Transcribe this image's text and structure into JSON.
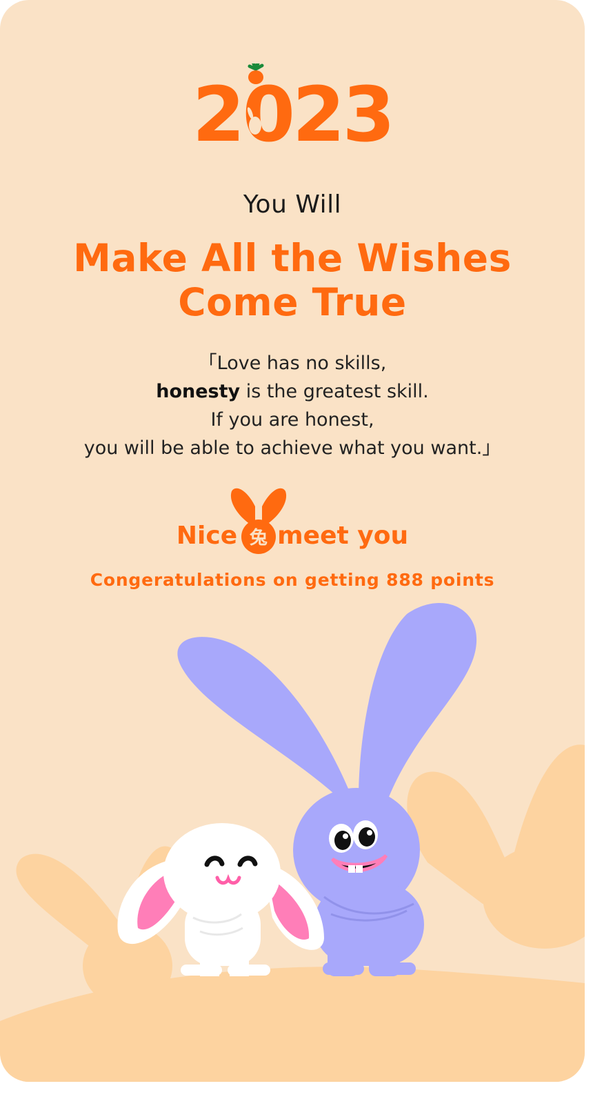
{
  "year": "2023",
  "subtitle": "You Will",
  "headline": {
    "line1": "Make All the Wishes",
    "line2": "Come True"
  },
  "quote": {
    "line1": "「Love has no skills,",
    "line2_bold": "honesty",
    "line2_rest": " is the greatest skill.",
    "line3": "If you are honest,",
    "line4": "you will be able to achieve what you want.」"
  },
  "greeting": {
    "left": "Nice",
    "right": "meet you"
  },
  "congrats": "Congeratulations on getting 888 points",
  "colors": {
    "background": "#fae2c6",
    "accent": "#ff6a10",
    "hills": "#fdd3a0",
    "purple_bunny": "#a8a8fb",
    "pink": "#ff7eb8"
  },
  "icons": {
    "logo": "year-2023-carrot-logo",
    "badge": "orange-bunny-badge-icon",
    "characters": [
      "white-bunny-character",
      "purple-bunny-character"
    ]
  }
}
